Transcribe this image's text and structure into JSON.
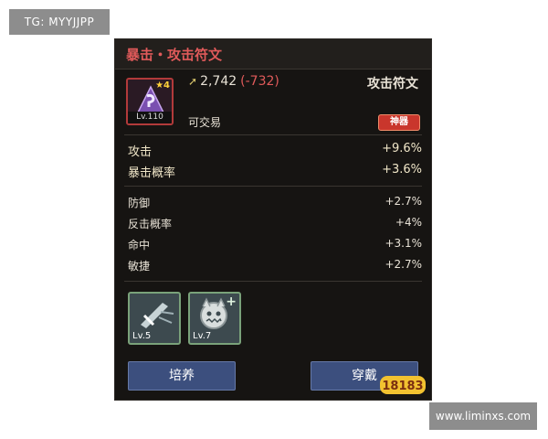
{
  "watermarks": {
    "top_left": "TG: MYYJJPP",
    "bottom_right": "www.liminxs.com",
    "logo_text": "18183"
  },
  "item": {
    "title": "暴击・攻击符文",
    "stars": "4",
    "level": "Lv.110",
    "power": "2,742",
    "power_delta": "(-732)",
    "type": "攻击符文",
    "tradeable": "可交易",
    "grade": "神器"
  },
  "main_stats": [
    {
      "label": "攻击",
      "value": "+9.6%"
    },
    {
      "label": "暴击概率",
      "value": "+3.6%"
    }
  ],
  "sub_stats": [
    {
      "label": "防御",
      "value": "+2.7%"
    },
    {
      "label": "反击概率",
      "value": "+4%"
    },
    {
      "label": "命中",
      "value": "+3.1%"
    },
    {
      "label": "敏捷",
      "value": "+2.7%"
    }
  ],
  "skills": [
    {
      "icon": "sword-strike-icon",
      "level": "Lv.5"
    },
    {
      "icon": "demon-face-plus-icon",
      "level": "Lv.7",
      "badge": "+"
    }
  ],
  "buttons": {
    "cultivate": "培养",
    "equip": "穿戴"
  },
  "colors": {
    "panel_bg": "#161412",
    "title_red": "#e05a5a",
    "grade_red": "#c9362c",
    "button_blue": "#3c4f7e",
    "skill_border": "#7aa27a"
  }
}
